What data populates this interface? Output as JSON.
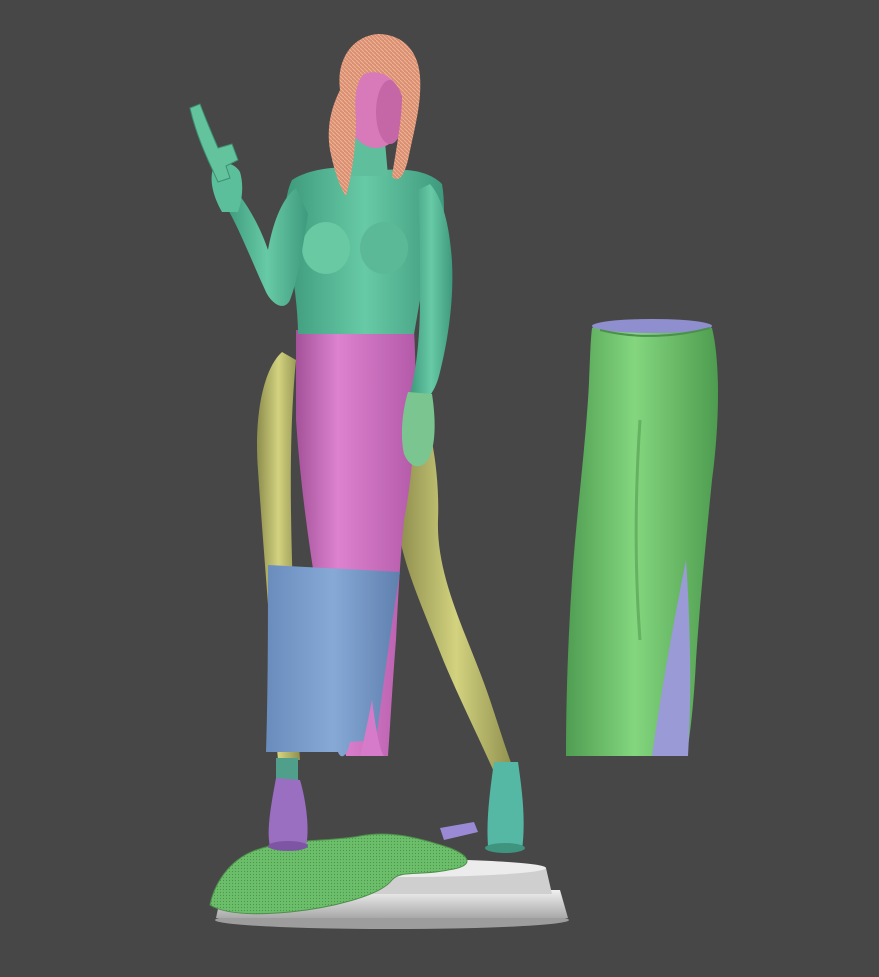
{
  "scene": {
    "background": "#474747",
    "colors": {
      "skin": "#5bbf9c",
      "skin_dark": "#3f9c7c",
      "top": "#62c39d",
      "face": "#d879b9",
      "hair": "#e29a7e",
      "skirt_pink": "#d374c6",
      "skirt_blue": "#7b9fce",
      "legs_yellow": "#c0c070",
      "shoe_purple": "#9a6ec0",
      "shoe_teal": "#55b8a4",
      "cloth_green": "#6cbf6a",
      "base_white": "#dcdcdc",
      "pants_green": "#6ec76c",
      "pants_lavender": "#9a9ad6",
      "gun": "#62c39d"
    },
    "objects": [
      "figurine",
      "pistol",
      "skirt",
      "pants-part",
      "base",
      "draped-cloth"
    ]
  }
}
